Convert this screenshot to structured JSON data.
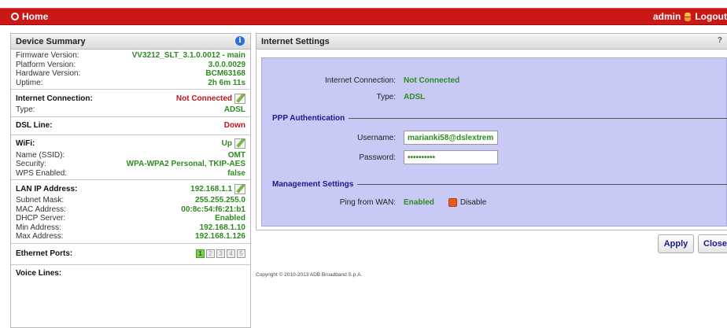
{
  "topbar": {
    "home_label": "Home",
    "user": "admin",
    "logout": "Logout"
  },
  "summary": {
    "title": "Device Summary",
    "firmware_label": "Firmware Version:",
    "firmware_value": "VV3212_SLT_3.1.0.0012 - main",
    "platform_label": "Platform Version:",
    "platform_value": "3.0.0.0029",
    "hardware_label": "Hardware Version:",
    "hardware_value": "BCM63168",
    "uptime_label": "Uptime:",
    "uptime_value": "2h 6m 11s",
    "inet_label": "Internet Connection:",
    "inet_value": "Not Connected",
    "type_label": "Type:",
    "type_value": "ADSL",
    "dsl_label": "DSL Line:",
    "dsl_value": "Down",
    "wifi_label": "WiFi:",
    "wifi_value": "Up",
    "ssid_label": "Name (SSID):",
    "ssid_value": "OMT",
    "security_label": "Security:",
    "security_value": "WPA-WPA2 Personal, TKIP-AES",
    "wps_label": "WPS Enabled:",
    "wps_value": "false",
    "lan_label": "LAN IP Address:",
    "lan_value": "192.168.1.1",
    "subnet_label": "Subnet Mask:",
    "subnet_value": "255.255.255.0",
    "mac_label": "MAC Address:",
    "mac_value": "00:8c:54:f6:21:b1",
    "dhcp_label": "DHCP Server:",
    "dhcp_value": "Enabled",
    "min_label": "Min Address:",
    "min_value": "192.168.1.10",
    "max_label": "Max Address:",
    "max_value": "192.168.1.126",
    "eth_label": "Ethernet Ports:",
    "ports": [
      "1",
      "2",
      "3",
      "4",
      "5"
    ],
    "voice_label": "Voice Lines:"
  },
  "settings": {
    "title": "Internet Settings",
    "corner_mark": "?",
    "conn_label": "Internet Connection:",
    "conn_value": "Not Connected",
    "type_label": "Type:",
    "type_value": "ADSL",
    "ppp_legend": "PPP Authentication",
    "username_label": "Username:",
    "username_value": "marianki58@dslextrem",
    "password_label": "Password:",
    "password_value": "••••••••••",
    "mgmt_legend": "Management Settings",
    "ping_label": "Ping from WAN:",
    "ping_value": "Enabled",
    "disable_label": "Disable"
  },
  "buttons": {
    "apply": "Apply",
    "close": "Close"
  },
  "copyright": "Copyright © 2010-2013 ADB Broadband S.p.A."
}
